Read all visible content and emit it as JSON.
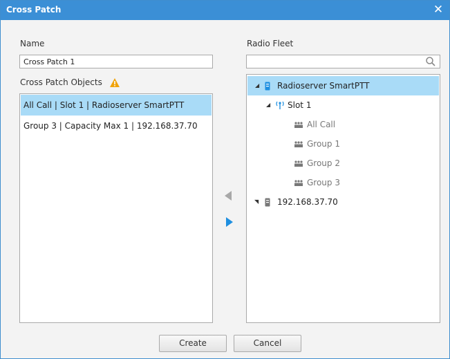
{
  "window": {
    "title": "Cross Patch",
    "close_icon": "close-icon"
  },
  "name_section": {
    "label": "Name",
    "value": "Cross Patch 1"
  },
  "objects_section": {
    "label": "Cross Patch Objects",
    "warning_icon": "warning-icon",
    "items": [
      {
        "label": "All Call | Slot 1 | Radioserver SmartPTT",
        "selected": true
      },
      {
        "label": "Group 3 | Capacity Max 1 | 192.168.37.70",
        "selected": false
      }
    ]
  },
  "fleet_section": {
    "label": "Radio Fleet",
    "search_value": "",
    "search_icon": "search-icon",
    "tree": [
      {
        "label": "Radioserver SmartPTT",
        "icon": "radio-server-icon",
        "expanded": true,
        "selected": true
      },
      {
        "label": "Slot 1",
        "icon": "antenna-icon",
        "expanded": true
      },
      {
        "label": "All Call",
        "icon": "group-icon"
      },
      {
        "label": "Group 1",
        "icon": "group-icon"
      },
      {
        "label": "Group 2",
        "icon": "group-icon"
      },
      {
        "label": "Group 3",
        "icon": "group-icon"
      },
      {
        "label": "192.168.37.70",
        "icon": "radio-server-icon",
        "expanded": false
      }
    ]
  },
  "move_buttons": {
    "left_icon": "arrow-left-icon",
    "right_icon": "arrow-right-icon"
  },
  "buttons": {
    "create": "Create",
    "cancel": "Cancel"
  },
  "colors": {
    "accent": "#3b8fd6",
    "selection": "#a9dbf7",
    "warning": "#f0a30a"
  }
}
